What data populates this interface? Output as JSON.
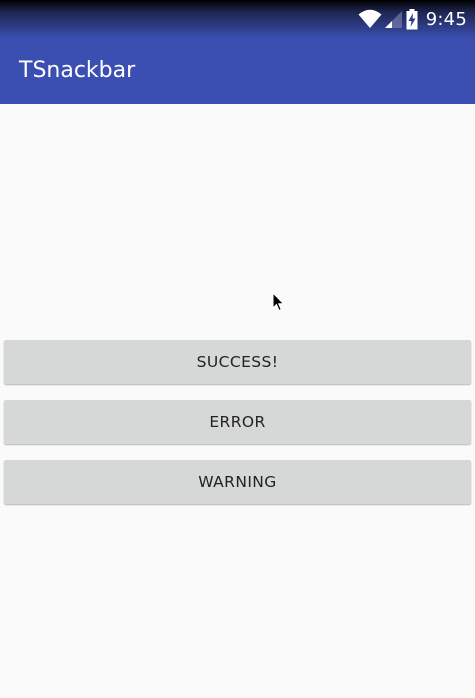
{
  "status_bar": {
    "time": "9:45",
    "icons": [
      "wifi-icon",
      "cell-signal-icon",
      "battery-charging-icon"
    ]
  },
  "app_bar": {
    "title": "TSnackbar",
    "color": "#3b4fb2"
  },
  "buttons": {
    "success_label": "SUCCESS!",
    "error_label": "ERROR",
    "warning_label": "WARNING"
  },
  "colors": {
    "background": "#fafafa",
    "button_bg": "#d6d7d7",
    "button_text": "#222222"
  }
}
